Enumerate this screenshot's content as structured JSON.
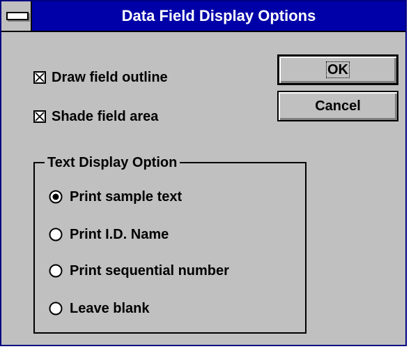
{
  "window": {
    "title": "Data Field Display Options"
  },
  "options": {
    "outline": {
      "label": "Draw field outline",
      "checked": true
    },
    "shade": {
      "label": "Shade field area",
      "checked": true
    }
  },
  "buttons": {
    "ok": "OK",
    "cancel": "Cancel"
  },
  "text_display": {
    "group_label": "Text Display Option",
    "selected": "sample",
    "items": [
      {
        "id": "sample",
        "label": "Print sample text"
      },
      {
        "id": "idname",
        "label": "Print I.D. Name"
      },
      {
        "id": "sequential",
        "label": "Print sequential number"
      },
      {
        "id": "blank",
        "label": "Leave blank"
      }
    ]
  },
  "colors": {
    "titlebar": "#0000a8",
    "dialog_face": "#c0c0c0"
  }
}
